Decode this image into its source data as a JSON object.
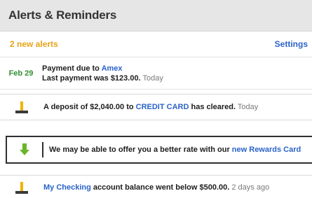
{
  "header": {
    "title": "Alerts & Reminders"
  },
  "subheader": {
    "new_alerts": "2 new alerts",
    "settings": "Settings"
  },
  "alerts": [
    {
      "date": "Feb 29",
      "line1_pre": "Payment due to ",
      "line1_link": "Amex",
      "line2_text": "Last payment was $123.00.",
      "line2_ts": " Today"
    },
    {
      "icon": "warning-icon",
      "pre": "A deposit of $2,040.00 to ",
      "link": "CREDIT CARD",
      "post": " has cleared.",
      "ts": " Today"
    },
    {
      "icon": "arrow-down-icon",
      "pre": "We may be able to offer you a better rate with our ",
      "link": "new Rewards Card"
    },
    {
      "icon": "warning-icon",
      "link": "My Checking",
      "post": " account balance went below $500.00.",
      "ts": " 2 days ago"
    }
  ],
  "colors": {
    "accent_orange": "#e8a317",
    "link_blue": "#2a63c9",
    "date_green": "#2f8f2f",
    "header_bg": "#e6e6e6"
  }
}
